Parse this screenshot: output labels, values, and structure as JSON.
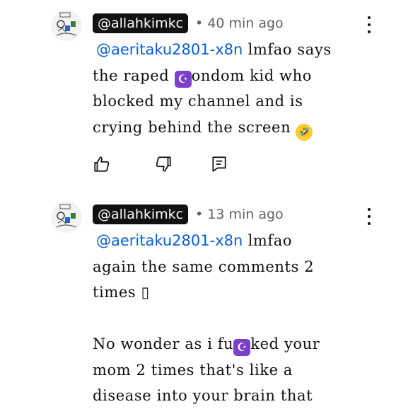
{
  "comments": [
    {
      "author": "@allahkimkc",
      "time": "• 40 min ago",
      "mention": "@aeritaku2801-x8n",
      "line1_rest": " lmfao says",
      "line2_before": "the raped ",
      "line2_after": "ondom kid who",
      "line3": "blocked my channel and is",
      "line4": "crying behind the screen ",
      "emoji_moon": "☪",
      "emoji_laugh": "🤣"
    },
    {
      "author": "@allahkimkc",
      "time": "• 13 min ago",
      "mention": "@aeritaku2801-x8n",
      "line1_rest": " lmfao",
      "line2": "again the same comments 2",
      "line3": "times ",
      "tofu": "▯",
      "line5_before": "No wonder as i fu",
      "line5_after": "ked your",
      "line6": "mom 2 times that's like a",
      "line7": "disease into your brain that",
      "emoji_moon": "☪"
    }
  ],
  "icons": {
    "like": "thumbs-up-icon",
    "dislike": "thumbs-down-icon",
    "reply": "reply-comment-icon",
    "menu": "more-vert-icon"
  },
  "colors": {
    "mention": "#065fd4",
    "handle_bg": "#111111",
    "meta": "#606060"
  }
}
